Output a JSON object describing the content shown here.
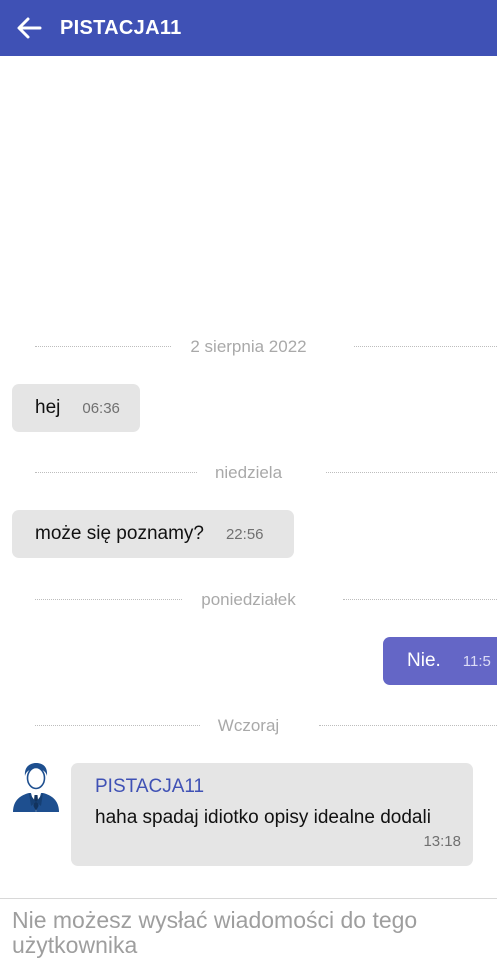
{
  "header": {
    "title": "PISTACJA11",
    "back_icon": "arrow-left-icon",
    "background": "#3f51b5"
  },
  "chat": {
    "dividers": [
      "2 sierpnia 2022",
      "niedziela",
      "poniedziałek",
      "Wczoraj"
    ],
    "messages": [
      {
        "text": "hej",
        "time": "06:36",
        "direction": "incoming"
      },
      {
        "text": "może się poznamy?",
        "time": "22:56",
        "direction": "incoming"
      },
      {
        "text": "Nie.",
        "time": "11:5",
        "direction": "outgoing"
      }
    ],
    "last_message": {
      "sender": "PISTACJA11",
      "text": "haha spadaj idiotko opisy idealne dodali",
      "time": "13:18",
      "avatar_icon": "user-avatar-icon"
    }
  },
  "footer": {
    "notice": "Nie możesz wysłać wiadomości do tego użytkownika"
  },
  "colors": {
    "accent": "#3f51b5",
    "outgoing_bubble": "#6466c6",
    "incoming_bubble": "#e5e5e5"
  }
}
